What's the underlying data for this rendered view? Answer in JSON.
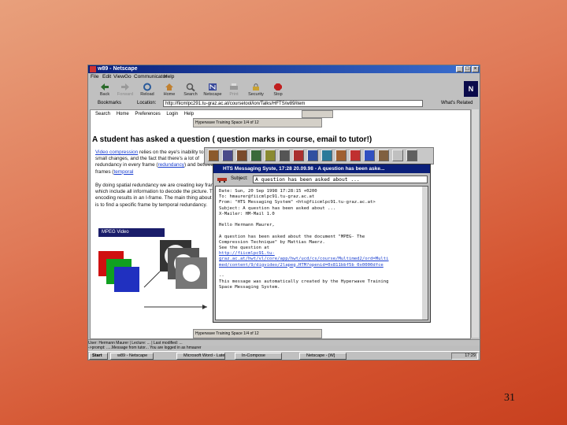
{
  "slide_number": "31",
  "browser": {
    "title": "w89 - Netscape",
    "menu": [
      "File",
      "Edit",
      "View",
      "Go",
      "Communicator",
      "Help"
    ],
    "toolbar": [
      {
        "label": "Back",
        "icon": "back-arrow-icon"
      },
      {
        "label": "Forward",
        "icon": "forward-arrow-icon"
      },
      {
        "label": "Reload",
        "icon": "reload-icon"
      },
      {
        "label": "Home",
        "icon": "home-icon"
      },
      {
        "label": "Search",
        "icon": "search-icon"
      },
      {
        "label": "Netscape",
        "icon": "netscape-icon"
      },
      {
        "label": "Print",
        "icon": "print-icon"
      },
      {
        "label": "Security",
        "icon": "lock-icon"
      },
      {
        "label": "Stop",
        "icon": "stop-icon"
      }
    ],
    "bookmarks_label": "Bookmarks",
    "location_label": "Location:",
    "location_value": "http://fiicmlpc291.tu-graz.ac.at/coursetool/ion/Talks/HFTS/w89/item",
    "related_label": "What's Related"
  },
  "page": {
    "nav": [
      "Search",
      "Home",
      "Preferences",
      "Login",
      "Help"
    ],
    "frame_label_top": "Hyperwave Training Space 1/4 of 12",
    "frame_label_bottom": "Hyperwave Training Space 1/4 of 12",
    "heading": "A student has asked a question ( question marks in course, email to tutor!)",
    "para1_link1": "Video compression",
    "para1_text": " relies on the eye's inability to see small changes, and the fact that there's a lot of redundancy in every frame (",
    "para1_link2": "redundancy",
    "para1_text2": ") and between frames (",
    "para1_link3": "temporal",
    "para2_text": "By doing spatial redundancy we are creating key frames which include all information to decode the picture. The encoding results in an I-frame. The main thing about this is to find a specific frame by temporal redundancy.",
    "mpeg_banner": "MPEG Video"
  },
  "message_window": {
    "title": "HTS Messaging Syste, 17:28 20.09.98 - A question has been aske...",
    "subject_label": "Subject:",
    "subject_value": "A question has been asked about ...",
    "body_lines": [
      "Date: Sun, 20 Sep 1998 17:28:15 +0200",
      "To: hmaurer@fiicmlpc91.tu-graz.ac.at",
      "From: \"HTS Messaging System\" <hts@fiicmlpc91.tu-graz.ac.at>",
      "Subject: A question has been asked about ...",
      "X-Mailer: HM-Mail 1.0",
      "",
      "Hello Hermann Maurer,",
      "",
      "A question has been asked about the document \"MPEG- The",
      "Compression Technique\" by Mattias Maerz.",
      "See the question at"
    ],
    "body_link_lines": [
      "http://fiicmlpc91.tu-",
      "graz.ac.at/hwt/vl/core/app/hwt/ucd/cs/course/Multimed2/ord=Multi",
      "med/content/9/digvideo/2lapeg.HTM?openid=0x811bbf5b_0x0000dfce"
    ],
    "body_footer": [
      "--",
      "This message was automatically created by the Hyperwave Training",
      "Space Messaging System."
    ]
  },
  "status": {
    "line1": "User: Hermann Maurer | Lecture: ... | Last modified: ...",
    "line2": "->prompt: .....Message from tutor... You are logged in as hmaurer"
  },
  "taskbar": {
    "start": "Start",
    "tasks": [
      "w89 - Netscape",
      "Microsoft Word - Latei",
      "In-Compose",
      "Netscape - [W]"
    ],
    "clock": "17:29"
  }
}
